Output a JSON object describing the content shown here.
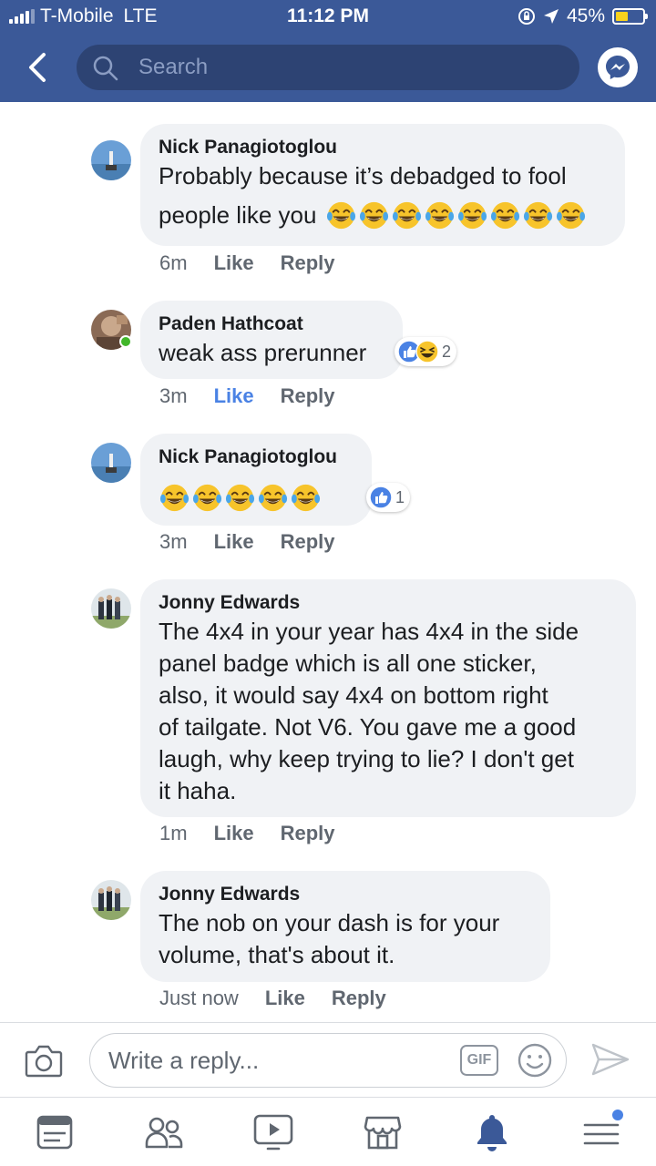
{
  "status_bar": {
    "carrier": "T-Mobile",
    "network": "LTE",
    "time": "11:12 PM",
    "battery_percent": "45%",
    "battery_level": 0.45
  },
  "header": {
    "search_placeholder": "Search",
    "back_icon": "chevron-left-icon",
    "messenger_icon": "messenger-icon"
  },
  "comments": [
    {
      "author": "Nick Panagiotoglou",
      "text": "Probably because it’s debadged to fool",
      "text_line2": "people like you",
      "emoji_count": 8,
      "emoji": "tears-of-joy",
      "time": "6m",
      "like": "Like",
      "reply": "Reply"
    },
    {
      "author": "Paden Hathcoat",
      "text": "weak ass prerunner",
      "reactions": "2",
      "reaction_icons": [
        "like-icon",
        "laughing-icon"
      ],
      "time": "3m",
      "like": "Like",
      "liked": true,
      "reply": "Reply"
    },
    {
      "author": "Nick Panagiotoglou",
      "emoji_count": 5,
      "emoji": "tears-of-joy",
      "reactions": "1",
      "reaction_icons": [
        "like-icon"
      ],
      "time": "3m",
      "like": "Like",
      "reply": "Reply"
    },
    {
      "author": "Jonny Edwards",
      "lines": [
        "The 4x4 in your year has 4x4 in the side",
        "panel badge which is all one sticker,",
        "also, it would say 4x4 on bottom right",
        "of tailgate. Not V6. You gave me a good",
        "laugh, why keep trying to lie? I don't get",
        "it haha."
      ],
      "time": "1m",
      "like": "Like",
      "reply": "Reply"
    },
    {
      "author": "Jonny Edwards",
      "lines": [
        "The nob on your dash is for your",
        "volume, that's about it."
      ],
      "time": "Just now",
      "like": "Like",
      "reply": "Reply"
    }
  ],
  "composer": {
    "placeholder": "Write a reply...",
    "gif_label": "GIF",
    "camera_icon": "camera-icon",
    "sticker_icon": "smiley-icon",
    "send_icon": "send-icon"
  },
  "tabs": [
    "news-feed-icon",
    "friends-icon",
    "watch-icon",
    "marketplace-icon",
    "notifications-icon",
    "menu-icon"
  ],
  "colors": {
    "header": "#3b5998",
    "search_bg": "#2d4373",
    "bubble": "#f0f2f5",
    "accent": "#4a82e4",
    "meta_text": "#606770"
  }
}
